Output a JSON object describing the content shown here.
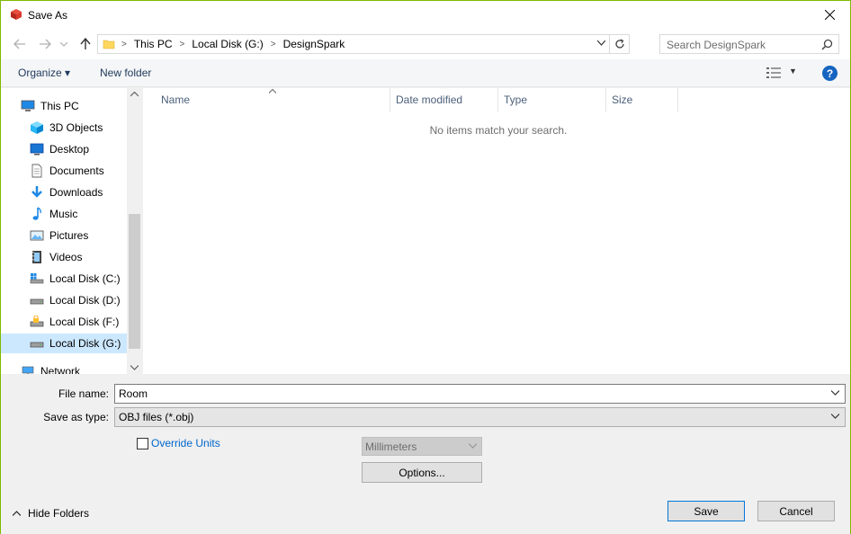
{
  "window": {
    "title": "Save As"
  },
  "address": {
    "crumbs": [
      "This PC",
      "Local Disk (G:)",
      "DesignSpark"
    ]
  },
  "search": {
    "placeholder": "Search DesignSpark"
  },
  "toolbar": {
    "organize_label": "Organize ▾",
    "new_folder_label": "New folder",
    "help_label": "?"
  },
  "nav": {
    "items": [
      {
        "label": "This PC",
        "icon": "computer-icon"
      },
      {
        "label": "3D Objects",
        "icon": "cube-icon"
      },
      {
        "label": "Desktop",
        "icon": "desktop-icon"
      },
      {
        "label": "Documents",
        "icon": "documents-icon"
      },
      {
        "label": "Downloads",
        "icon": "download-icon"
      },
      {
        "label": "Music",
        "icon": "music-icon"
      },
      {
        "label": "Pictures",
        "icon": "pictures-icon"
      },
      {
        "label": "Videos",
        "icon": "videos-icon"
      },
      {
        "label": "Local Disk (C:)",
        "icon": "drive-icon"
      },
      {
        "label": "Local Disk (D:)",
        "icon": "drive-icon"
      },
      {
        "label": "Local Disk (F:)",
        "icon": "drive-icon"
      },
      {
        "label": "Local Disk (G:)",
        "icon": "drive-icon"
      },
      {
        "label": "Network",
        "icon": "network-icon"
      }
    ]
  },
  "columns": [
    "Name",
    "Date modified",
    "Type",
    "Size"
  ],
  "empty_message": "No items match your search.",
  "form": {
    "file_name_label": "File name:",
    "file_name_value": "Room",
    "save_type_label": "Save as type:",
    "save_type_value": "OBJ files (*.obj)",
    "override_units_label": "Override Units",
    "units_value": "Millimeters",
    "options_label": "Options..."
  },
  "buttons": {
    "save": "Save",
    "cancel": "Cancel",
    "hide_folders": "Hide Folders"
  }
}
